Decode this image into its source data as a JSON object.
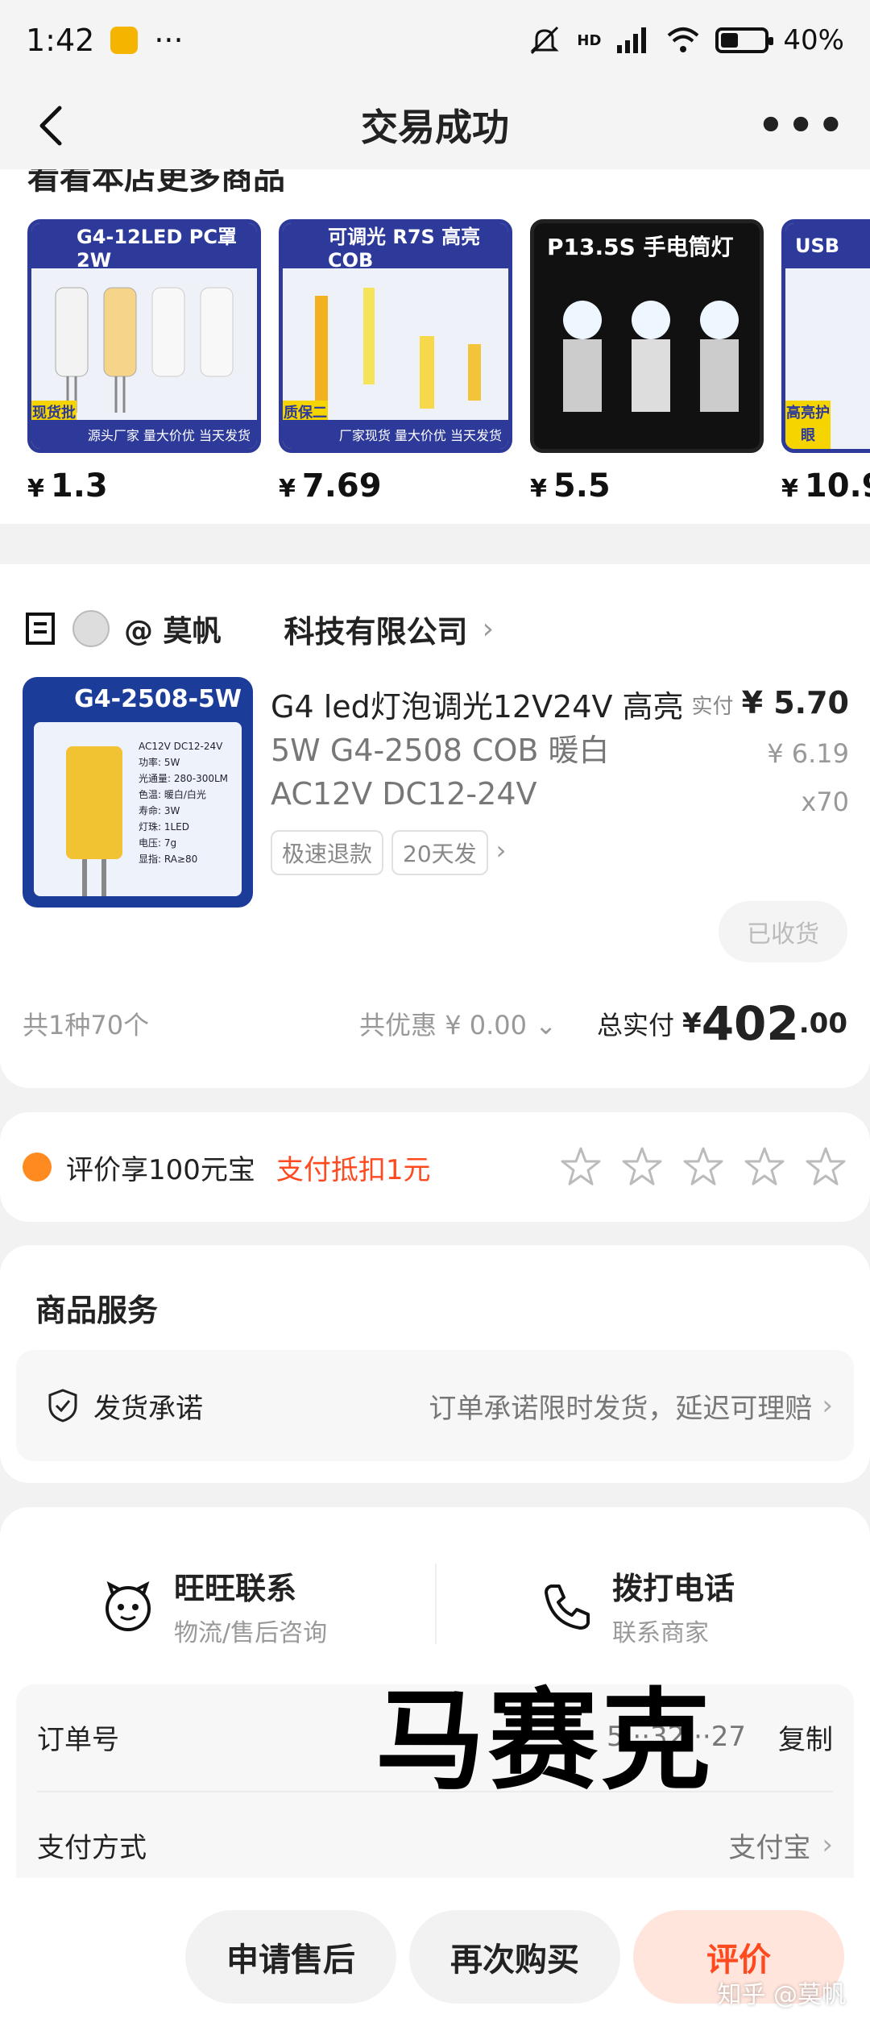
{
  "status_bar": {
    "time": "1:42",
    "dots": "···",
    "network": "HD",
    "battery": "40%",
    "battery_level": 0.4
  },
  "nav": {
    "title": "交易成功",
    "more": "•••"
  },
  "recommend": {
    "title": "看看本店更多商品",
    "items": [
      {
        "banner": "G4-12LED PC罩 2W",
        "badge": "现货批发",
        "foot": "源头厂家 量大价优 当天发货",
        "price": "1.3"
      },
      {
        "banner": "可调光 R7S 高亮 COB",
        "badge": "质保二年",
        "foot": "厂家现货 量大价优 当天发货",
        "price": "7.69"
      },
      {
        "banner": "P13.5S 手电筒灯",
        "price": "5.5"
      },
      {
        "banner": "USB",
        "badge": "高亮护眼",
        "price": "10.9"
      }
    ],
    "currency": "¥"
  },
  "order": {
    "shop_name": "@ 莫帆",
    "shop_company": "科技有限公司",
    "product_image_header": "G4-2508-5W",
    "product_image_specs": [
      "AC12V DC12-24V",
      "功率: 5W",
      "光通量: 280-300LM",
      "色温: 暖白/白光",
      "寿命: 3W",
      "灯珠: 1LED",
      "电压: 7g",
      "显指: RA≥80"
    ],
    "product_title": "G4 led灯泡调光12V24V 高亮",
    "product_sku": "5W G4-2508 COB 暖白 AC12V DC12-24V",
    "paid_label": "实付",
    "paid_price": "¥ 5.70",
    "original_price": "¥ 6.19",
    "quantity": "x70",
    "tags": [
      "极速退款",
      "20天发"
    ],
    "received_label": "已收货",
    "count_text": "共1种70个",
    "discount_text": "共优惠 ¥ 0.00",
    "total_label": "总实付",
    "total_currency": "¥",
    "total_int": "402",
    "total_dec": ".00"
  },
  "review": {
    "text": "评价享100元宝",
    "accent": "支付抵扣1元",
    "stars": 5
  },
  "service": {
    "title": "商品服务",
    "row_label": "发货承诺",
    "row_value": "订单承诺限时发货，延迟可理赔"
  },
  "contact": {
    "ww_title": "旺旺联系",
    "ww_sub": "物流/售后咨询",
    "phone_title": "拨打电话",
    "phone_sub": "联系商家"
  },
  "info": {
    "order_no_label": "订单号",
    "order_no_value": "5···32···27",
    "copy_label": "复制",
    "pay_label": "支付方式",
    "pay_value": "支付宝"
  },
  "mosaic_text": "马赛克",
  "actions": {
    "after_sale": "申请售后",
    "rebuy": "再次购买",
    "review": "评价"
  },
  "watermark": "知乎 @莫帆",
  "colors": {
    "accent": "#ff4a1f",
    "brand_blue": "#2d3a9a",
    "star_stroke": "#bbbbbb"
  }
}
